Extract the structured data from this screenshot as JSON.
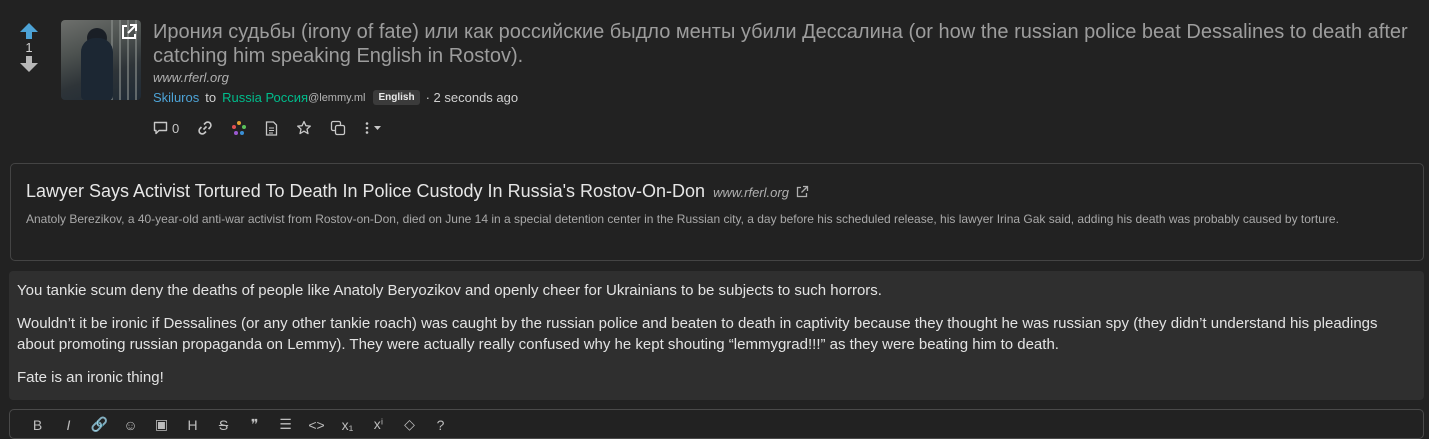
{
  "post": {
    "score": "1",
    "title": "Ирония судьбы (irony of fate) или как российские быдло менты убили Дессалина (or how the russian police beat Dessalines to death after catching him speaking English in Rostov).",
    "domain": "www.rferl.org",
    "author": "Skiluros",
    "to_label": "to",
    "community": "Russia Россия",
    "community_instance": "@lemmy.ml",
    "language": "English",
    "time": "· 2 seconds ago",
    "comment_count": "0"
  },
  "link_card": {
    "title": "Lawyer Says Activist Tortured To Death In Police Custody In Russia's Rostov-On-Don",
    "domain": "www.rferl.org",
    "description": "Anatoly Berezikov, a 40-year-old anti-war activist from Rostov-on-Don, died on June 14 in a special detention center in the Russian city, a day before his scheduled release, his lawyer Irina Gak said, adding his death was probably caused by torture."
  },
  "body": {
    "paragraphs": [
      "You tankie scum deny the deaths of people like Anatoly Beryozikov and openly cheer for Ukrainians to be subjects to such horrors.",
      "Wouldn’t it be ironic if Dessalines (or any other tankie roach) was caught by the russian police and beaten to death in captivity because they thought he was russian spy (they didn’t understand his pleadings about promoting russian propaganda on Lemmy). They were actually really confused why he kept shouting “lemmygrad!!!” as they were beating him to death.",
      "Fate is an ironic thing!"
    ]
  },
  "editor": {
    "tools": [
      "B",
      "I",
      "🔗",
      "☺",
      "▣",
      "H",
      "S",
      "❞",
      "☰",
      "<>",
      "x₁",
      "xⁱ",
      "◇",
      "?"
    ]
  },
  "colors": {
    "upvote": "#4da3d6",
    "user": "#4da3d6",
    "community": "#00bc8c",
    "background": "#222222"
  }
}
